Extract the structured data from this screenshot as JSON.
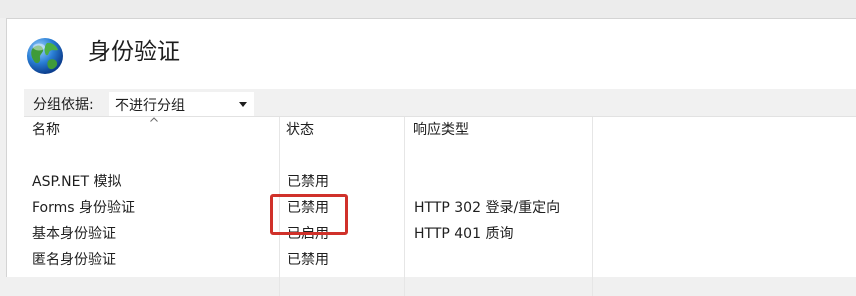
{
  "header": {
    "title": "身份验证",
    "icon": "globe-icon"
  },
  "grouping": {
    "label": "分组依据:",
    "selected": "不进行分组"
  },
  "table": {
    "columns": [
      "名称",
      "状态",
      "响应类型"
    ],
    "sorted_column": "名称",
    "rows": [
      {
        "name": "ASP.NET 模拟",
        "status": "已禁用",
        "response": ""
      },
      {
        "name": "Forms 身份验证",
        "status": "已禁用",
        "response": "HTTP 302 登录/重定向"
      },
      {
        "name": "基本身份验证",
        "status": "已启用",
        "response": "HTTP 401 质询"
      },
      {
        "name": "匿名身份验证",
        "status": "已禁用",
        "response": ""
      }
    ]
  },
  "colors": {
    "highlight": "#d0312a"
  }
}
